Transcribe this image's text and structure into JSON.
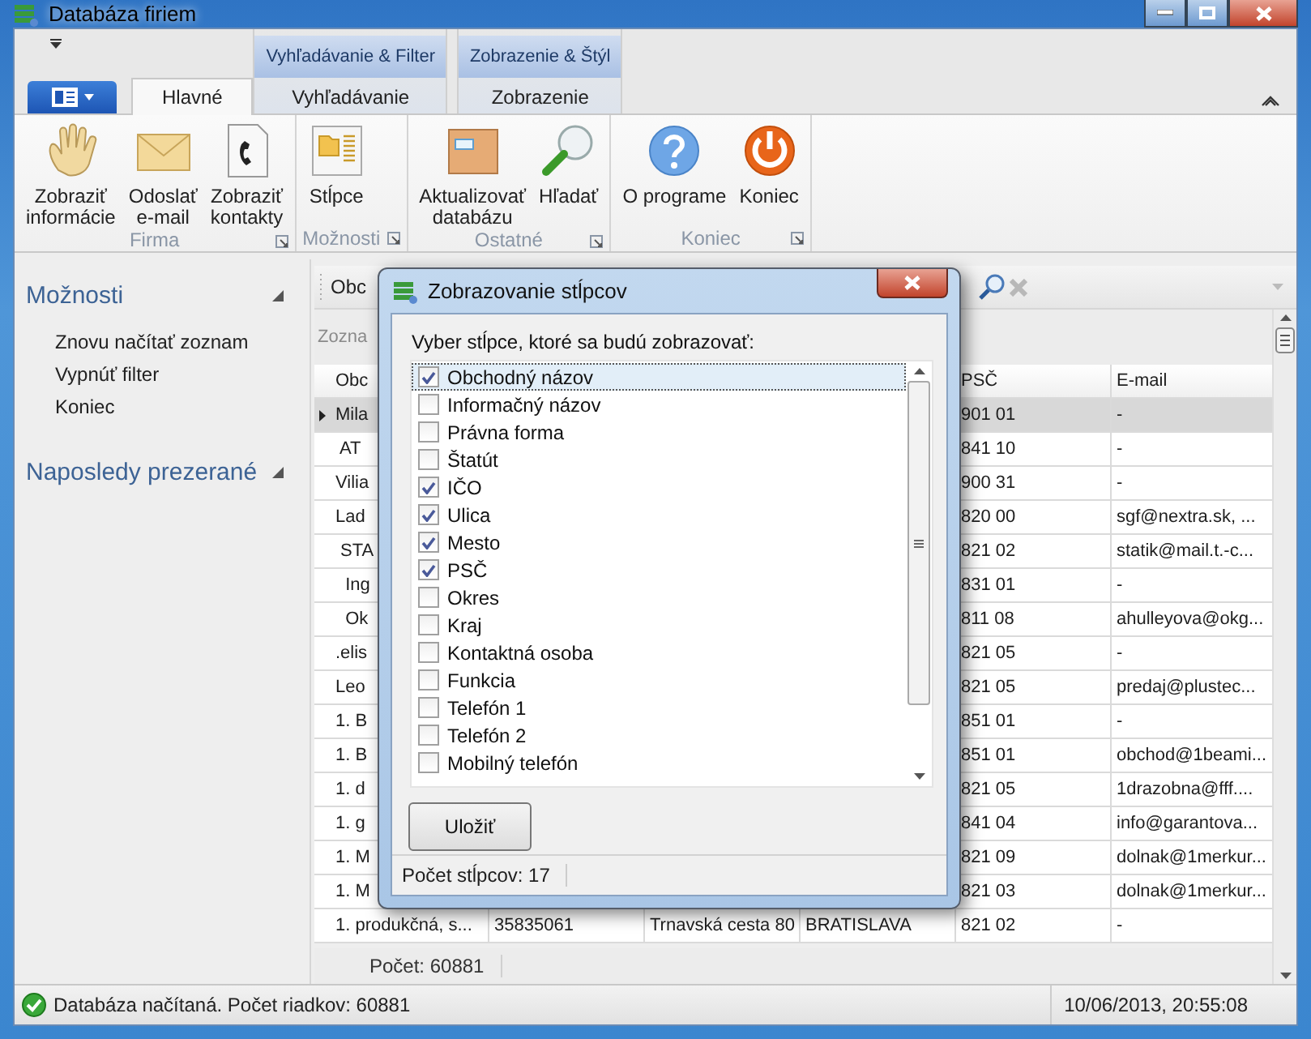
{
  "window": {
    "title": "Databáza firiem"
  },
  "ribbon": {
    "context_groups": [
      {
        "label": "Vyhľadávanie & Filter"
      },
      {
        "label": "Zobrazenie & Štýl"
      }
    ],
    "tabs": [
      {
        "label": "Hlavné",
        "selected": true
      },
      {
        "label": "Vyhľadávanie",
        "selected": false
      },
      {
        "label": "Zobrazenie",
        "selected": false
      }
    ],
    "groups": [
      {
        "label": "Firma",
        "buttons": [
          {
            "label": "Zobraziť\ninformácie",
            "kind": "hand"
          },
          {
            "label": "Odoslať\ne-mail",
            "kind": "envelope"
          },
          {
            "label": "Zobraziť\nkontakty",
            "kind": "phone"
          }
        ]
      },
      {
        "label": "Možnosti",
        "buttons": [
          {
            "label": "Stĺpce",
            "kind": "columns"
          }
        ]
      },
      {
        "label": "Ostatné",
        "buttons": [
          {
            "label": "Aktualizovať\ndatabázu",
            "kind": "box"
          },
          {
            "label": "Hľadať",
            "kind": "search"
          }
        ]
      },
      {
        "label": "Koniec",
        "buttons": [
          {
            "label": "O programe",
            "kind": "help"
          },
          {
            "label": "Koniec",
            "kind": "power"
          }
        ]
      }
    ]
  },
  "side_panel": [
    {
      "title": "Možnosti",
      "items": [
        "Znovu načítať zoznam",
        "Vypnúť filter",
        "Koniec"
      ]
    },
    {
      "title": "Naposledy prezerané"
    }
  ],
  "grid": {
    "filter_value": "Obc",
    "group_hint": "Zozna",
    "columns": [
      "Obc",
      null,
      null,
      null,
      "PSČ",
      "E-mail"
    ],
    "rows": [
      {
        "selected": true,
        "cells": [
          "Mila",
          null,
          null,
          null,
          "901 01",
          "-"
        ]
      },
      {
        "selected": false,
        "cells": [
          " AT",
          null,
          null,
          null,
          "841 10",
          "-"
        ]
      },
      {
        "selected": false,
        "cells": [
          "Vilia",
          null,
          null,
          null,
          "900 31",
          "-"
        ]
      },
      {
        "selected": false,
        "cells": [
          "Lad",
          null,
          null,
          null,
          "820 00",
          "sgf@nextra.sk, ..."
        ]
      },
      {
        "selected": false,
        "cells": [
          " STA",
          null,
          null,
          null,
          "821 02",
          "statik@mail.t.-c..."
        ]
      },
      {
        "selected": false,
        "cells": [
          "  Ing",
          null,
          null,
          null,
          "831 01",
          "-"
        ]
      },
      {
        "selected": false,
        "cells": [
          "  Ok",
          null,
          null,
          null,
          "811 08",
          "ahulleyova@okg..."
        ]
      },
      {
        "selected": false,
        "cells": [
          ".elis",
          null,
          null,
          null,
          "821 05",
          "-"
        ]
      },
      {
        "selected": false,
        "cells": [
          "Leo",
          null,
          null,
          null,
          "821 05",
          "predaj@plustec..."
        ]
      },
      {
        "selected": false,
        "cells": [
          "1. B",
          null,
          null,
          null,
          "851 01",
          "-"
        ]
      },
      {
        "selected": false,
        "cells": [
          "1. B",
          null,
          null,
          null,
          "851 01",
          "obchod@1beami..."
        ]
      },
      {
        "selected": false,
        "cells": [
          "1. d",
          null,
          null,
          null,
          "821 05",
          "1drazobna@fff...."
        ]
      },
      {
        "selected": false,
        "cells": [
          "1. g",
          null,
          null,
          null,
          "841 04",
          "info@garantova..."
        ]
      },
      {
        "selected": false,
        "cells": [
          "1. M",
          null,
          null,
          null,
          "821 09",
          "dolnak@1merkur..."
        ]
      },
      {
        "selected": false,
        "cells": [
          "1. M",
          null,
          null,
          null,
          "821 03",
          "dolnak@1merkur..."
        ]
      },
      {
        "selected": false,
        "cells": [
          "1. produkčná, s...",
          "35835061",
          "Trnavská cesta 80",
          "BRATISLAVA",
          "821 02",
          "-"
        ]
      }
    ],
    "footer": "Počet: 60881"
  },
  "dialog": {
    "title": "Zobrazovanie stĺpcov",
    "prompt": "Vyber stĺpce, ktoré sa budú zobrazovať:",
    "items": [
      {
        "label": "Obchodný názov",
        "checked": true,
        "selected": true
      },
      {
        "label": "Informačný názov",
        "checked": false,
        "selected": false
      },
      {
        "label": "Právna forma",
        "checked": false,
        "selected": false
      },
      {
        "label": "Štatút",
        "checked": false,
        "selected": false
      },
      {
        "label": "IČO",
        "checked": true,
        "selected": false
      },
      {
        "label": "Ulica",
        "checked": true,
        "selected": false
      },
      {
        "label": "Mesto",
        "checked": true,
        "selected": false
      },
      {
        "label": "PSČ",
        "checked": true,
        "selected": false
      },
      {
        "label": "Okres",
        "checked": false,
        "selected": false
      },
      {
        "label": "Kraj",
        "checked": false,
        "selected": false
      },
      {
        "label": "Kontaktná osoba",
        "checked": false,
        "selected": false
      },
      {
        "label": "Funkcia",
        "checked": false,
        "selected": false
      },
      {
        "label": "Telefón 1",
        "checked": false,
        "selected": false
      },
      {
        "label": "Telefón 2",
        "checked": false,
        "selected": false
      },
      {
        "label": "Mobilný telefón",
        "checked": false,
        "selected": false
      }
    ],
    "button": "Uložiť",
    "status": "Počet stĺpcov: 17"
  },
  "status_bar": {
    "message": "Databáza načítaná. Počet riadkov: 60881",
    "datetime": "10/06/2013, 20:55:08"
  }
}
